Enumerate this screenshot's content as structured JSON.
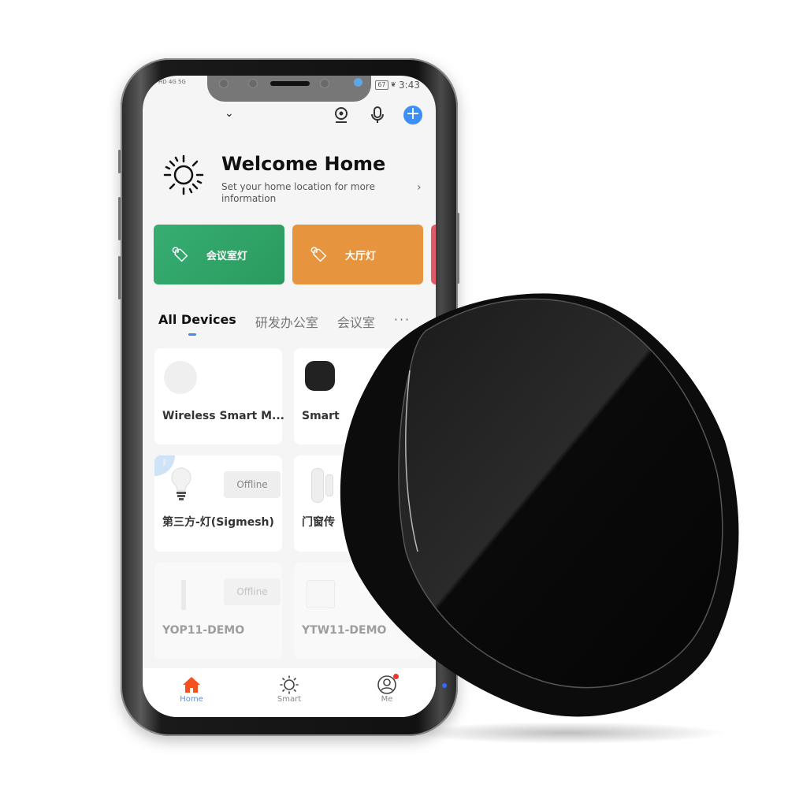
{
  "status_bar": {
    "time": "3:43",
    "battery": "67",
    "signal_left": "HD 4G 5G"
  },
  "topbar": {
    "dropdown_icon": "chevron-down-icon",
    "camera_icon": "camera-icon",
    "mic_icon": "microphone-icon",
    "add_label": "+"
  },
  "welcome": {
    "title": "Welcome Home",
    "subtitle": "Set your home location for more information",
    "arrow": "›"
  },
  "scenes": [
    {
      "label": "会议室灯",
      "color": "#2fa366"
    },
    {
      "label": "大厅灯",
      "color": "#e7943e"
    },
    {
      "label": "",
      "color": "#e05a68"
    }
  ],
  "tabs": [
    {
      "label": "All Devices",
      "active": true
    },
    {
      "label": "研发办公室",
      "active": false
    },
    {
      "label": "会议室",
      "active": false
    }
  ],
  "tabs_more": "···",
  "devices": [
    {
      "name": "Wireless Smart M...",
      "status": ""
    },
    {
      "name": "Smart",
      "status": ""
    },
    {
      "name": "第三方-灯(Sigmesh)",
      "status": "Offline"
    },
    {
      "name": "门窗传",
      "status": ""
    },
    {
      "name": "YOP11-DEMO",
      "status": "Offline"
    },
    {
      "name": "YTW11-DEMO",
      "status": ""
    }
  ],
  "navbar": [
    {
      "label": "Home",
      "active": true
    },
    {
      "label": "Smart",
      "active": false
    },
    {
      "label": "Me",
      "active": false
    }
  ],
  "colors": {
    "accent": "#3e8ef7",
    "home_icon": "#f4511e",
    "active_tab_indicator": "#4a88e6"
  }
}
